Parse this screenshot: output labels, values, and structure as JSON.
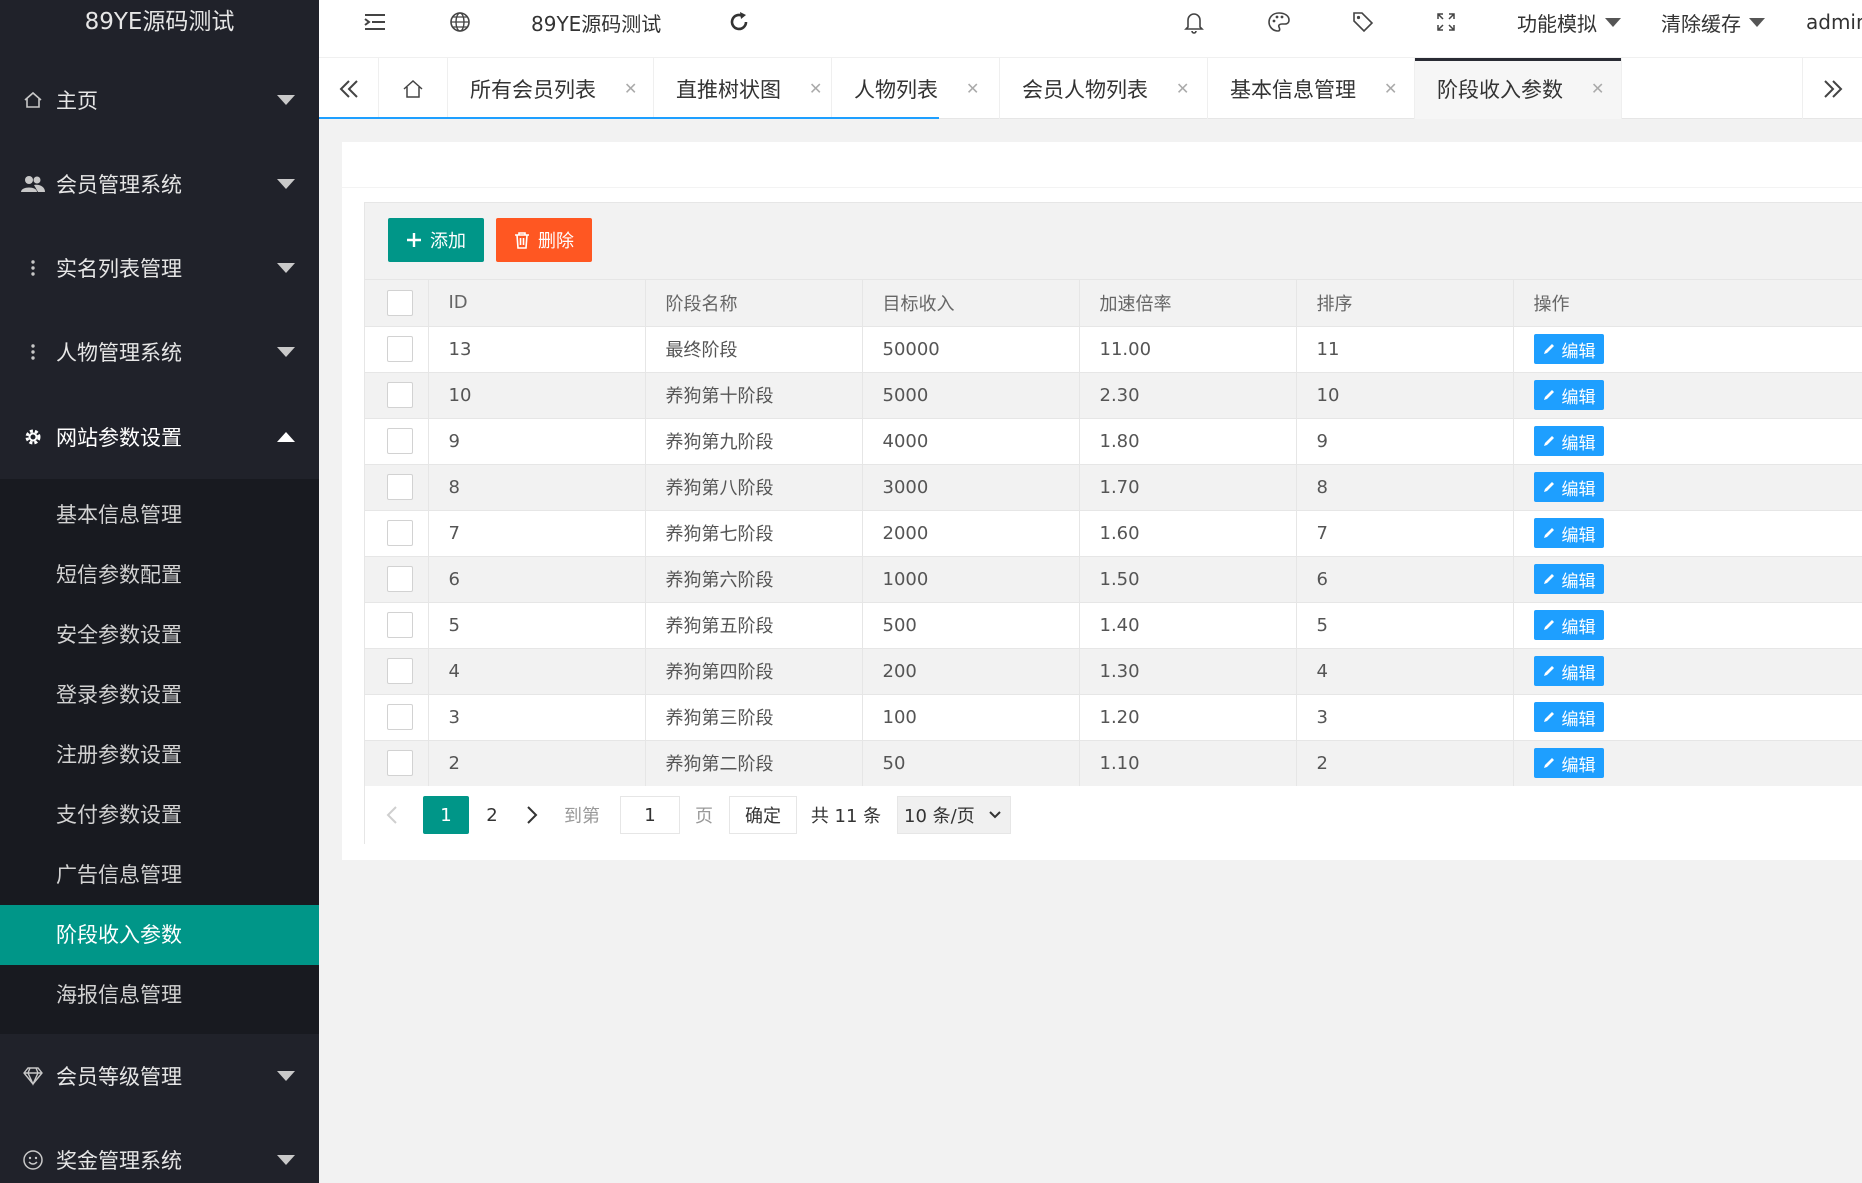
{
  "app_title": "89YE源码测试",
  "sidebar": {
    "menus": [
      {
        "label": "主页",
        "icon": "home-icon"
      },
      {
        "label": "会员管理系统",
        "icon": "users-icon"
      },
      {
        "label": "实名列表管理",
        "icon": "more-vertical-icon"
      },
      {
        "label": "人物管理系统",
        "icon": "more-vertical-icon"
      },
      {
        "label": "网站参数设置",
        "icon": "gear-icon"
      }
    ],
    "submenu": [
      {
        "label": "基本信息管理"
      },
      {
        "label": "短信参数配置"
      },
      {
        "label": "安全参数设置"
      },
      {
        "label": "登录参数设置"
      },
      {
        "label": "注册参数设置"
      },
      {
        "label": "支付参数设置"
      },
      {
        "label": "广告信息管理"
      },
      {
        "label": "阶段收入参数"
      },
      {
        "label": "海报信息管理"
      }
    ],
    "menus_bottom": [
      {
        "label": "会员等级管理",
        "icon": "diamond-icon"
      },
      {
        "label": "奖金管理系统",
        "icon": "smile-icon"
      }
    ]
  },
  "header": {
    "site_label": "89YE源码测试",
    "feature_menu": "功能模拟",
    "cache_menu": "清除缓存",
    "user": "admin"
  },
  "tabs": [
    {
      "label": "所有会员列表"
    },
    {
      "label": "直推树状图"
    },
    {
      "label": "人物列表"
    },
    {
      "label": "会员人物列表"
    },
    {
      "label": "基本信息管理"
    },
    {
      "label": "阶段收入参数"
    }
  ],
  "toolbar": {
    "add_label": "添加",
    "delete_label": "删除"
  },
  "table": {
    "columns": [
      "ID",
      "阶段名称",
      "目标收入",
      "加速倍率",
      "排序",
      "操作"
    ],
    "edit_label": "编辑",
    "rows": [
      {
        "id": "13",
        "name": "最终阶段",
        "target": "50000",
        "rate": "11.00",
        "sort": "11"
      },
      {
        "id": "10",
        "name": "养狗第十阶段",
        "target": "5000",
        "rate": "2.30",
        "sort": "10"
      },
      {
        "id": "9",
        "name": "养狗第九阶段",
        "target": "4000",
        "rate": "1.80",
        "sort": "9"
      },
      {
        "id": "8",
        "name": "养狗第八阶段",
        "target": "3000",
        "rate": "1.70",
        "sort": "8"
      },
      {
        "id": "7",
        "name": "养狗第七阶段",
        "target": "2000",
        "rate": "1.60",
        "sort": "7"
      },
      {
        "id": "6",
        "name": "养狗第六阶段",
        "target": "1000",
        "rate": "1.50",
        "sort": "6"
      },
      {
        "id": "5",
        "name": "养狗第五阶段",
        "target": "500",
        "rate": "1.40",
        "sort": "5"
      },
      {
        "id": "4",
        "name": "养狗第四阶段",
        "target": "200",
        "rate": "1.30",
        "sort": "4"
      },
      {
        "id": "3",
        "name": "养狗第三阶段",
        "target": "100",
        "rate": "1.20",
        "sort": "3"
      },
      {
        "id": "2",
        "name": "养狗第二阶段",
        "target": "50",
        "rate": "1.10",
        "sort": "2"
      }
    ]
  },
  "pager": {
    "page1": "1",
    "page2": "2",
    "goto_label": "到第",
    "goto_value": "1",
    "page_unit": "页",
    "confirm_label": "确定",
    "total": "共 11 条",
    "per_page": "10 条/页"
  },
  "colors": {
    "primary": "#009688",
    "danger": "#ff5722",
    "info": "#1e9fff",
    "sidebar": "#20222a"
  }
}
